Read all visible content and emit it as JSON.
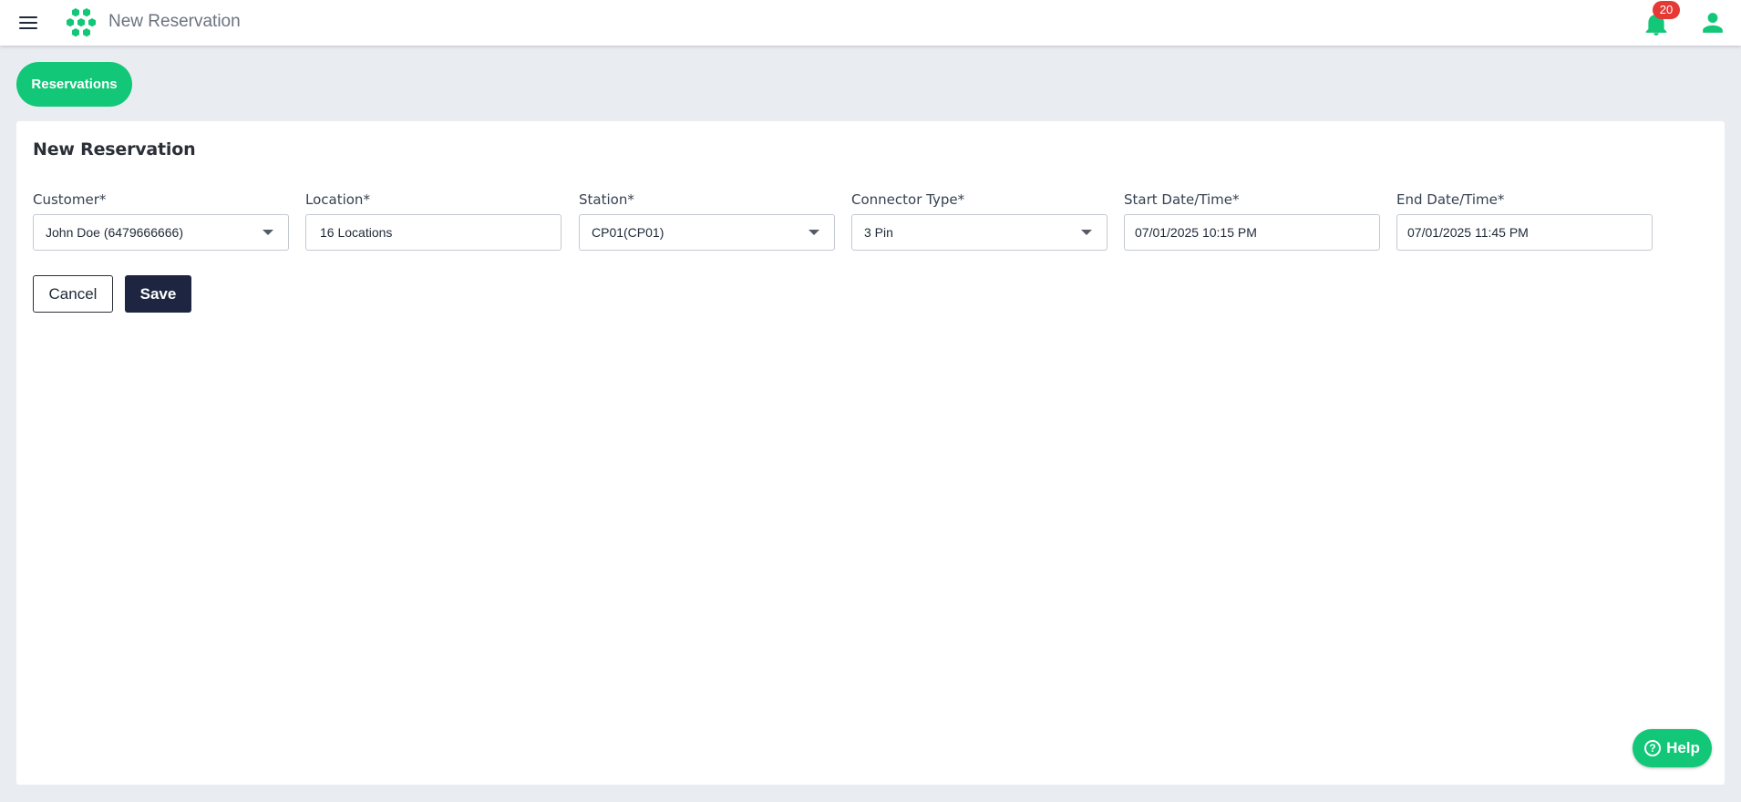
{
  "header": {
    "title": "New Reservation",
    "notification_count": "20",
    "brand_color": "#12c777"
  },
  "tabs": {
    "reservations_label": "Reservations"
  },
  "form": {
    "title": "New Reservation",
    "fields": {
      "customer": {
        "label": "Customer*",
        "value": "John Doe (6479666666)",
        "type": "select"
      },
      "location": {
        "label": "Location*",
        "value": "16 Locations",
        "type": "select"
      },
      "station": {
        "label": "Station*",
        "value": "CP01(CP01)",
        "type": "select"
      },
      "connector_type": {
        "label": "Connector Type*",
        "value": "3 Pin",
        "type": "select"
      },
      "start_datetime": {
        "label": "Start Date/Time*",
        "value": "07/01/2025 10:15 PM",
        "type": "datetime"
      },
      "end_datetime": {
        "label": "End Date/Time*",
        "value": "07/01/2025 11:45 PM",
        "type": "datetime"
      }
    },
    "cancel_label": "Cancel",
    "save_label": "Save"
  },
  "help": {
    "label": "Help",
    "icon": "?"
  },
  "icons": {
    "menu": "menu-icon",
    "logo": "hexagon-cluster-logo",
    "notifications": "bell-icon",
    "user": "user-icon",
    "caret": "chevron-down-icon",
    "help": "question-circle-icon"
  },
  "colors": {
    "accent": "#12c777",
    "badge": "#e53935",
    "save_button": "#1e2540",
    "background": "#e9ecf1"
  }
}
